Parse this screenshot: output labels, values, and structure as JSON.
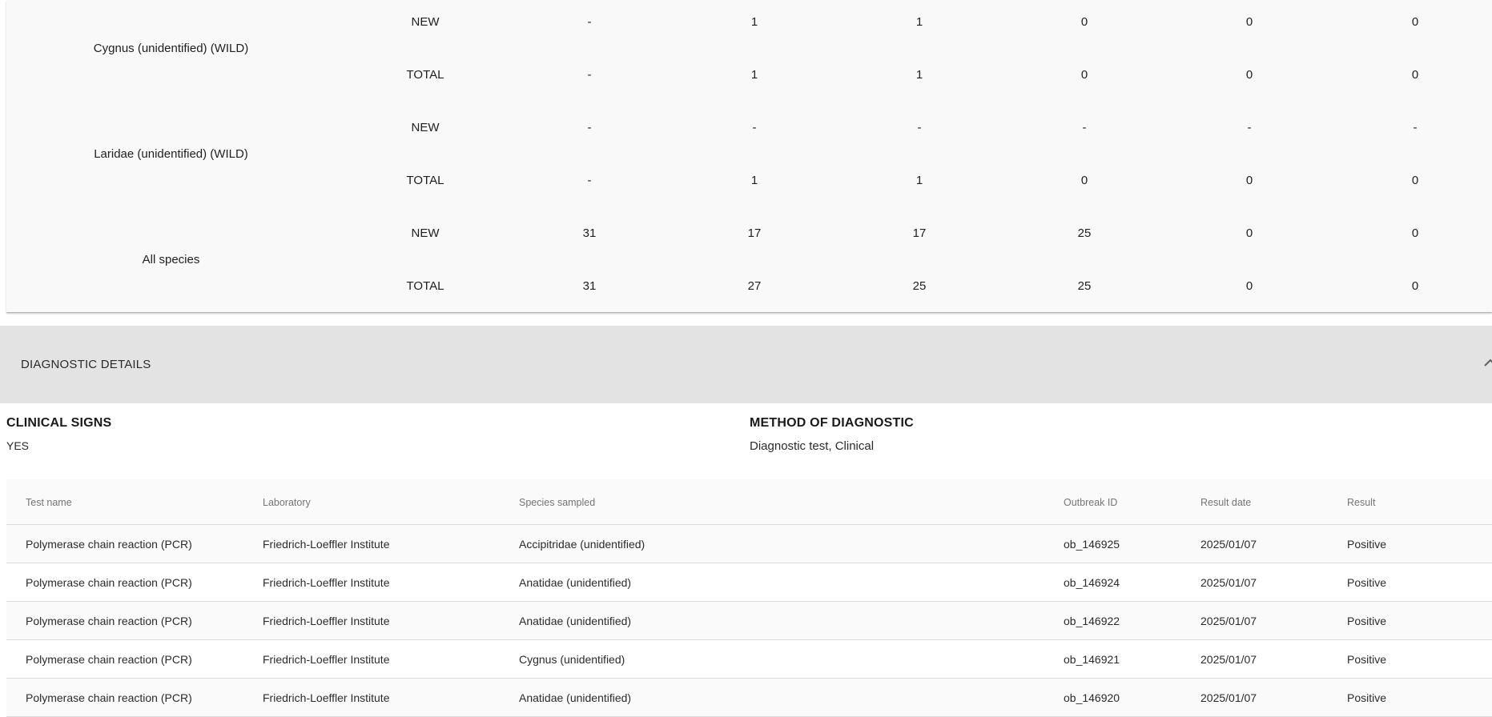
{
  "species_table": {
    "groups": [
      {
        "name": "Cygnus (unidentified) (WILD)",
        "rows": [
          {
            "type": "NEW",
            "values": [
              "-",
              "1",
              "1",
              "0",
              "0",
              "0"
            ]
          },
          {
            "type": "TOTAL",
            "values": [
              "-",
              "1",
              "1",
              "0",
              "0",
              "0"
            ]
          }
        ]
      },
      {
        "name": "Laridae (unidentified) (WILD)",
        "rows": [
          {
            "type": "NEW",
            "values": [
              "-",
              "-",
              "-",
              "-",
              "-",
              "-"
            ]
          },
          {
            "type": "TOTAL",
            "values": [
              "-",
              "1",
              "1",
              "0",
              "0",
              "0"
            ]
          }
        ]
      },
      {
        "name": "All species",
        "rows": [
          {
            "type": "NEW",
            "values": [
              "31",
              "17",
              "17",
              "25",
              "0",
              "0"
            ]
          },
          {
            "type": "TOTAL",
            "values": [
              "31",
              "27",
              "25",
              "25",
              "0",
              "0"
            ]
          }
        ]
      }
    ]
  },
  "diagnostic_details": {
    "header_title": "DIAGNOSTIC DETAILS",
    "expanded_icon": "chevron-up-icon",
    "clinical_signs": {
      "label": "CLINICAL SIGNS",
      "value": "YES"
    },
    "method": {
      "label": "METHOD OF DIAGNOSTIC",
      "value": "Diagnostic test, Clinical"
    },
    "table": {
      "columns": [
        "Test name",
        "Laboratory",
        "Species sampled",
        "Outbreak ID",
        "Result date",
        "Result"
      ],
      "rows": [
        [
          "Polymerase chain reaction (PCR)",
          "Friedrich-Loeffler Institute",
          "Accipitridae (unidentified)",
          "ob_146925",
          "2025/01/07",
          "Positive"
        ],
        [
          "Polymerase chain reaction (PCR)",
          "Friedrich-Loeffler Institute",
          "Anatidae (unidentified)",
          "ob_146924",
          "2025/01/07",
          "Positive"
        ],
        [
          "Polymerase chain reaction (PCR)",
          "Friedrich-Loeffler Institute",
          "Anatidae (unidentified)",
          "ob_146922",
          "2025/01/07",
          "Positive"
        ],
        [
          "Polymerase chain reaction (PCR)",
          "Friedrich-Loeffler Institute",
          "Cygnus (unidentified)",
          "ob_146921",
          "2025/01/07",
          "Positive"
        ],
        [
          "Polymerase chain reaction (PCR)",
          "Friedrich-Loeffler Institute",
          "Anatidae (unidentified)",
          "ob_146920",
          "2025/01/07",
          "Positive"
        ]
      ]
    }
  }
}
